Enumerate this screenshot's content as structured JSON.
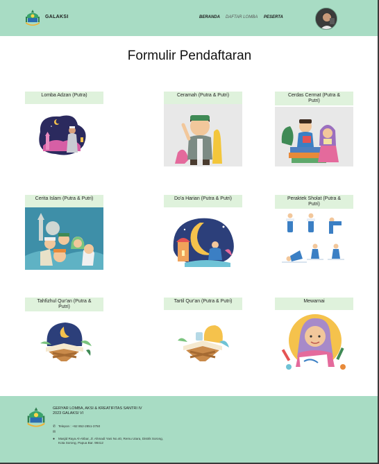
{
  "header": {
    "brand": "GALAKSI",
    "nav": [
      {
        "label": "BERANDA"
      },
      {
        "label": "DAFTAR LOMBA"
      },
      {
        "label": "PESERTA"
      }
    ]
  },
  "main": {
    "title": "Formulir Pendaftaran",
    "cards": [
      {
        "label": "Lomba Adzan (Putra)"
      },
      {
        "label": "Ceramah (Putra & Putri)"
      },
      {
        "label": "Cerdas Cermat (Putra & Putri)"
      },
      {
        "label": "Cerita Islam (Putra & Putri)"
      },
      {
        "label": "Do'a Harian (Putra & Putri)"
      },
      {
        "label": "Peraktek Sholat (Putra & Putri)"
      },
      {
        "label": "Tahfizhul Qur'an (Putra & Putri)"
      },
      {
        "label": "Tartil Qur'an (Putra & Putri)"
      },
      {
        "label": "Mewarnai"
      }
    ]
  },
  "footer": {
    "title_line1": "GERYAR LOMBA, AKSI & KREATIFITAS SANTRI IV",
    "title_line2": "2023 GALAKSI VI",
    "phone": "Telepon : +62 852-2851-3750",
    "email": "",
    "address_line1": "Masjid Raya Al-Akbar, Jl. Ahmadi Yani No.40, Remu Utara, Distrik Sorong,",
    "address_line2": "Kota Sorong, Papua Bar. 98412"
  },
  "colors": {
    "header_bg": "#a8dcc4",
    "card_label_bg": "#dff2dc",
    "footer_bg": "#a8dcc4"
  }
}
